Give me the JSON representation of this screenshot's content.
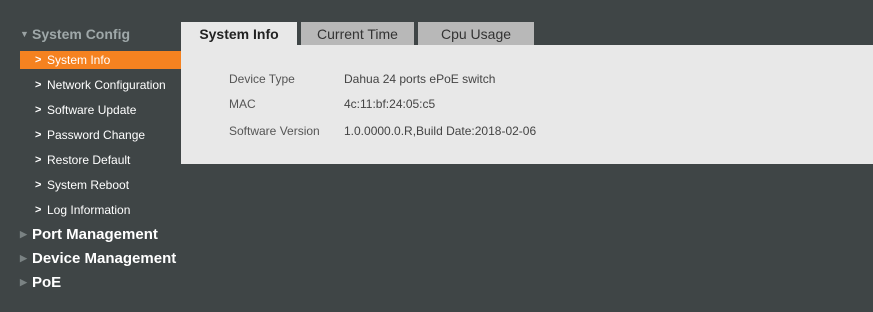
{
  "sidebar": {
    "system_config": {
      "label": "System Config",
      "items": [
        {
          "label": "System Info"
        },
        {
          "label": "Network Configuration"
        },
        {
          "label": "Software Update"
        },
        {
          "label": "Password Change"
        },
        {
          "label": "Restore Default"
        },
        {
          "label": "System Reboot"
        },
        {
          "label": "Log Information"
        }
      ]
    },
    "groups": [
      {
        "label": "Port Management"
      },
      {
        "label": "Device Management"
      },
      {
        "label": "PoE"
      }
    ]
  },
  "tabs": [
    {
      "label": "System Info"
    },
    {
      "label": "Current Time"
    },
    {
      "label": "Cpu Usage"
    }
  ],
  "info": {
    "device_type": {
      "label": "Device Type",
      "value": "Dahua 24 ports ePoE switch"
    },
    "mac": {
      "label": "MAC",
      "value": "4c:11:bf:24:05:c5"
    },
    "software_version": {
      "label": "Software Version",
      "value": "1.0.0000.0.R,Build Date:2018-02-06"
    }
  },
  "icons": {
    "expanded": "triangle-down-icon",
    "collapsed": "triangle-right-icon",
    "item": "chevron-right-icon"
  },
  "colors": {
    "background": "#3f4546",
    "accent": "#f58220",
    "panel": "#e8e8e8",
    "tab_inactive": "#b8b8b8"
  }
}
